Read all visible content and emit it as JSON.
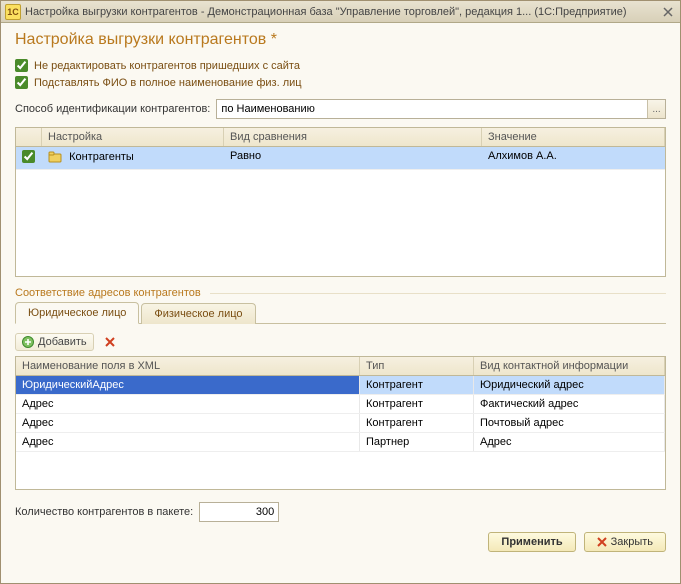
{
  "titlebar": {
    "icon_text": "1C",
    "text": "Настройка выгрузки контрагентов - Демонстрационная база \"Управление торговлей\", редакция 1...   (1С:Предприятие)"
  },
  "page_title": "Настройка выгрузки контрагентов *",
  "checks": {
    "no_edit": "Не редактировать контрагентов пришедших с сайта",
    "substitute_fio": "Подставлять ФИО в полное наименование физ. лиц"
  },
  "id_method": {
    "label": "Способ идентификации контрагентов:",
    "value": "по Наименованию",
    "btn": "..."
  },
  "grid1": {
    "head": {
      "c0": "",
      "c1": "Настройка",
      "c2": "Вид сравнения",
      "c3": "Значение"
    },
    "row": {
      "checked": true,
      "c1": "Контрагенты",
      "c2": "Равно",
      "c3": "Алхимов А.А."
    }
  },
  "section_label": "Соответствие адресов контрагентов",
  "tabs": {
    "legal": "Юридическое лицо",
    "individual": "Физическое лицо"
  },
  "toolbar": {
    "add": "Добавить"
  },
  "grid2": {
    "head": {
      "c0": "Наименование поля в XML",
      "c1": "Тип",
      "c2": "Вид контактной информации"
    },
    "rows": [
      {
        "c0": "ЮридическийАдрес",
        "c1": "Контрагент",
        "c2": "Юридический адрес",
        "sel": "primary"
      },
      {
        "c0": "Адрес",
        "c1": "Контрагент",
        "c2": "Фактический адрес"
      },
      {
        "c0": "Адрес",
        "c1": "Контрагент",
        "c2": "Почтовый адрес"
      },
      {
        "c0": "Адрес",
        "c1": "Партнер",
        "c2": "Адрес"
      }
    ]
  },
  "packet": {
    "label": "Количество контрагентов в пакете:",
    "value": "300"
  },
  "buttons": {
    "apply": "Применить",
    "close": "Закрыть"
  }
}
